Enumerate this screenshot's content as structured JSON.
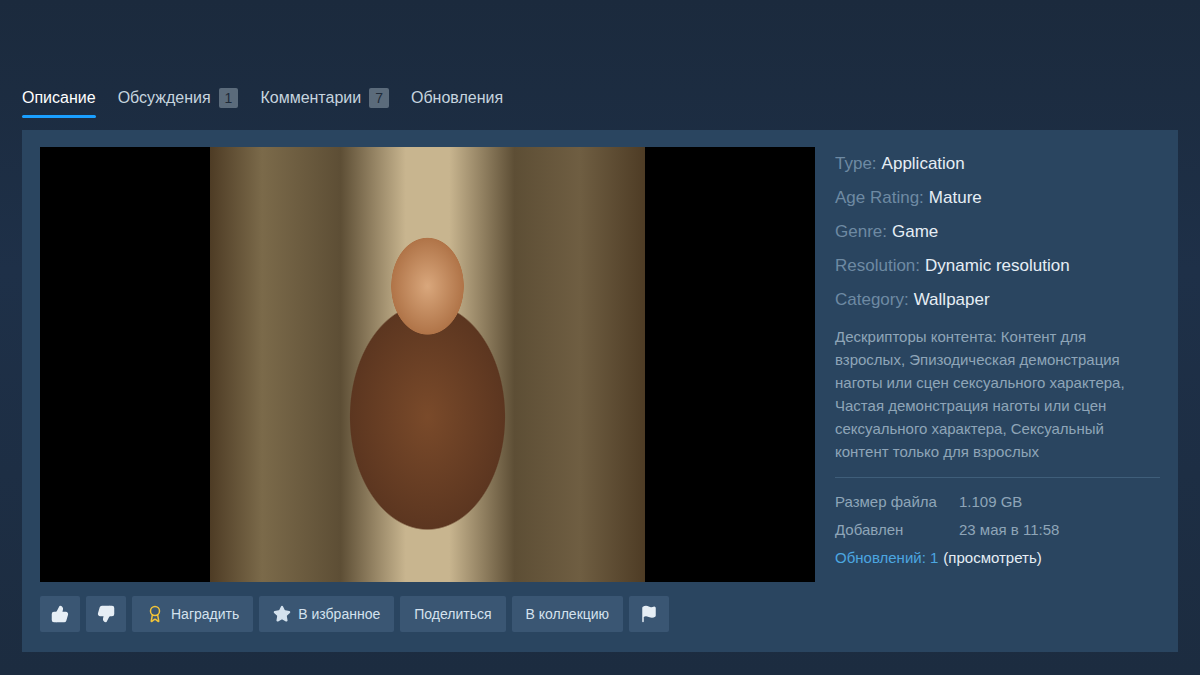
{
  "tabs": [
    {
      "label": "Описание",
      "count": null,
      "selected": true
    },
    {
      "label": "Обсуждения",
      "count": "1",
      "selected": false
    },
    {
      "label": "Комментарии",
      "count": "7",
      "selected": false
    },
    {
      "label": "Обновления",
      "count": null,
      "selected": false
    }
  ],
  "preview": {
    "kind": "picture"
  },
  "details": [
    {
      "label": "Type:",
      "value": "Application"
    },
    {
      "label": "Age Rating:",
      "value": "Mature"
    },
    {
      "label": "Genre:",
      "value": "Game"
    },
    {
      "label": "Resolution:",
      "value": "Dynamic resolution"
    },
    {
      "label": "Category:",
      "value": "Wallpaper"
    }
  ],
  "descriptors": {
    "label": "Дескрипторы контента:",
    "value": "Контент для взрослых, Эпизодическая демонстрация наготы или сцен сексуального характера, Частая демонстрация наготы или сцен сексуального характера, Сексуальный контент только для взрослых"
  },
  "file_info": [
    {
      "label": "Размер файла",
      "value": "1.109 GB"
    },
    {
      "label": "Добавлен",
      "value": "23 мая в 11:58"
    }
  ],
  "updates": {
    "label": "Обновлений: 1",
    "link": "(просмотреть)"
  },
  "buttons": [
    {
      "kind": "like",
      "label": ""
    },
    {
      "kind": "dislike",
      "label": ""
    },
    {
      "kind": "award",
      "label": "Наградить"
    },
    {
      "kind": "favorite",
      "label": "В избранное"
    },
    {
      "kind": "share",
      "label": "Поделиться"
    },
    {
      "kind": "collection",
      "label": "В коллекцию"
    },
    {
      "kind": "report",
      "label": ""
    }
  ]
}
